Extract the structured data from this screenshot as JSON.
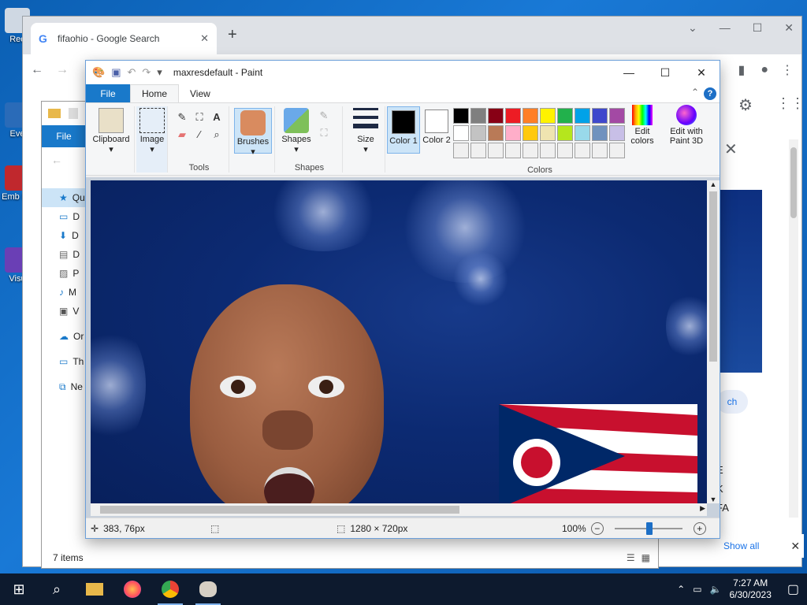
{
  "desktop": {
    "icons": [
      {
        "label": "Rec"
      },
      {
        "label": "Eve"
      },
      {
        "label": "Emb De"
      },
      {
        "label": "Visu"
      }
    ]
  },
  "chrome": {
    "tab_title": "fifaohio - Google Search",
    "new_tab": "+",
    "partial_right_texts": [
      "ch",
      "E",
      "K",
      "FA"
    ],
    "show_all": "Show all"
  },
  "explorer": {
    "file_tab": "File",
    "nav_items": [
      "Qu",
      "D",
      "D",
      "D",
      "P",
      "M",
      "V",
      "Or",
      "Th",
      "Ne"
    ],
    "status_items": "7 items"
  },
  "paint": {
    "title": "maxresdefault - Paint",
    "tabs": {
      "file": "File",
      "home": "Home",
      "view": "View"
    },
    "help": "?",
    "groups": {
      "clipboard": "Clipboard",
      "image": "Image",
      "tools": "Tools",
      "brushes": "Brushes",
      "shapes_btn": "Shapes",
      "shapes": "Shapes",
      "size": "Size",
      "color1": "Color 1",
      "color2": "Color 2",
      "colors": "Colors",
      "edit_colors": "Edit colors",
      "edit_paint3d": "Edit with Paint 3D"
    },
    "color1_value": "#000000",
    "color2_value": "#ffffff",
    "palette": [
      "#000000",
      "#7f7f7f",
      "#880015",
      "#ed1c24",
      "#ff7f27",
      "#fff200",
      "#22b14c",
      "#00a2e8",
      "#3f48cc",
      "#a349a4",
      "#ffffff",
      "#c3c3c3",
      "#b97a57",
      "#ffaec9",
      "#ffc90e",
      "#efe4b0",
      "#b5e61d",
      "#99d9ea",
      "#7092be",
      "#c8bfe7",
      "#f0f0f0",
      "#f0f0f0",
      "#f0f0f0",
      "#f0f0f0",
      "#f0f0f0",
      "#f0f0f0",
      "#f0f0f0",
      "#f0f0f0",
      "#f0f0f0",
      "#f0f0f0"
    ],
    "status": {
      "cursor_pos": "383, 76px",
      "image_size": "1280 × 720px",
      "zoom": "100%"
    }
  },
  "taskbar": {
    "time": "7:27 AM",
    "date": "6/30/2023"
  }
}
